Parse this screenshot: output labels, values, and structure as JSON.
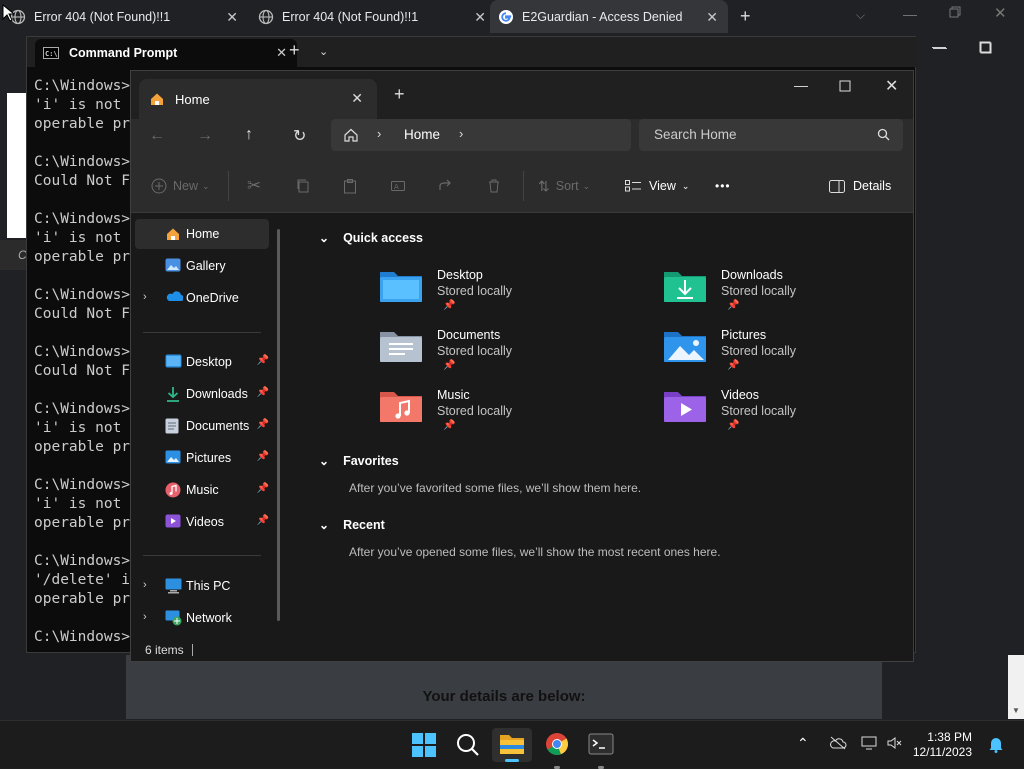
{
  "chrome": {
    "tabs": [
      {
        "title": "Error 404 (Not Found)!!1"
      },
      {
        "title": "Error 404 (Not Found)!!1"
      },
      {
        "title": "E2Guardian - Access Denied"
      }
    ],
    "new_tab": "+",
    "page_text": "Your details are below:"
  },
  "cmd": {
    "tab_title": "Command Prompt",
    "lines": [
      "C:\\Windows>",
      "'i' is not",
      "operable pr",
      "",
      "C:\\Windows>",
      "Could Not F",
      "",
      "C:\\Windows>",
      "'i' is not",
      "operable pr",
      "",
      "C:\\Windows>",
      "Could Not F",
      "",
      "C:\\Windows>",
      "Could Not F",
      "",
      "C:\\Windows>",
      "'i' is not",
      "operable pr",
      "",
      "C:\\Windows>",
      "'i' is not",
      "operable pr",
      "",
      "C:\\Windows>",
      "'/delete' i",
      "operable pr",
      "",
      "C:\\Windows>"
    ],
    "strip_letter": "C"
  },
  "explorer": {
    "tab_title": "Home",
    "breadcrumb": "Home",
    "search_placeholder": "Search Home",
    "toolbar": {
      "new": "New",
      "sort": "Sort",
      "view": "View",
      "more": "•••",
      "details": "Details"
    },
    "nav": {
      "top": [
        {
          "label": "Home"
        },
        {
          "label": "Gallery"
        },
        {
          "label": "OneDrive"
        }
      ],
      "pinned": [
        {
          "label": "Desktop"
        },
        {
          "label": "Downloads"
        },
        {
          "label": "Documents"
        },
        {
          "label": "Pictures"
        },
        {
          "label": "Music"
        },
        {
          "label": "Videos"
        }
      ],
      "bottom": [
        {
          "label": "This PC"
        },
        {
          "label": "Network"
        }
      ]
    },
    "quick_access": {
      "title": "Quick access",
      "items": [
        {
          "name": "Desktop",
          "sub": "Stored locally"
        },
        {
          "name": "Downloads",
          "sub": "Stored locally"
        },
        {
          "name": "Documents",
          "sub": "Stored locally"
        },
        {
          "name": "Pictures",
          "sub": "Stored locally"
        },
        {
          "name": "Music",
          "sub": "Stored locally"
        },
        {
          "name": "Videos",
          "sub": "Stored locally"
        }
      ]
    },
    "favorites": {
      "title": "Favorites",
      "note": "After you’ve favorited some files, we’ll show them here."
    },
    "recent": {
      "title": "Recent",
      "note": "After you’ve opened some files, we’ll show the most recent ones here."
    },
    "status": "6 items"
  },
  "taskbar": {
    "time": "1:38 PM",
    "date": "12/11/2023"
  },
  "colors": {
    "accent": "#4cc2ff",
    "folder": "#f0b429",
    "bg": "#191919"
  }
}
